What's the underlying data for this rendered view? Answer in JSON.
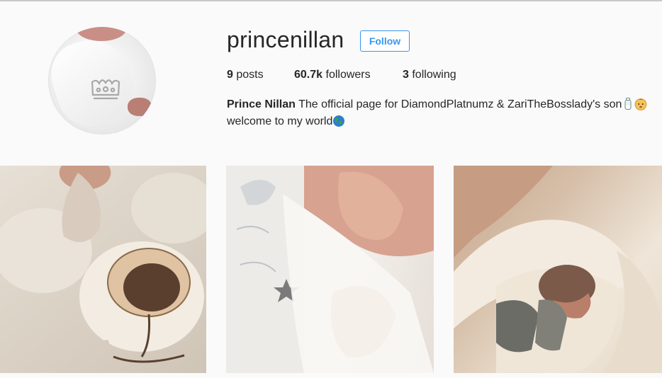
{
  "profile": {
    "username": "princenillan",
    "follow_label": "Follow",
    "stats": {
      "posts_count": "9",
      "posts_label": "posts",
      "followers_count": "60.7k",
      "followers_label": "followers",
      "following_count": "3",
      "following_label": "following"
    },
    "bio": {
      "name": "Prince Nillan",
      "line1": "The official page for DiamondPlatnumz & ZariTheBosslady's son",
      "line2": "welcome to my world"
    },
    "bio_emojis": [
      "baby-bottle-icon",
      "baby-face-icon",
      "globe-icon"
    ]
  },
  "posts": [
    {
      "name": "post-thumbnail-1",
      "description_icon": "teddy-bear-onesie-photo"
    },
    {
      "name": "post-thumbnail-2",
      "description_icon": "baby-hand-blanket-photo"
    },
    {
      "name": "post-thumbnail-3",
      "description_icon": "baby-wrapped-blanket-photo"
    }
  ],
  "colors": {
    "accent": "#3897f0",
    "text": "#262626",
    "background": "#fafafa"
  }
}
